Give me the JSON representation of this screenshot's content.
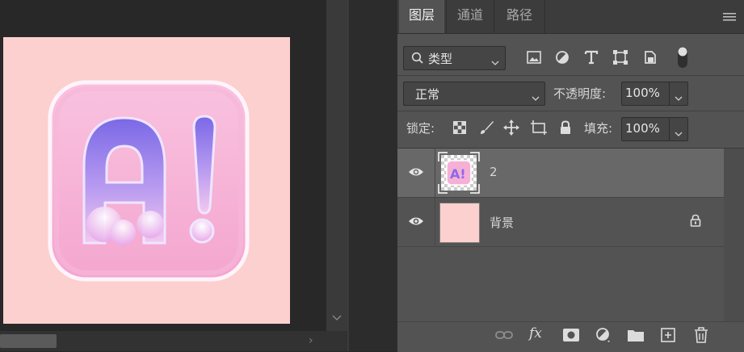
{
  "panel": {
    "tabs": [
      {
        "label": "图层",
        "active": true
      },
      {
        "label": "通道",
        "active": false
      },
      {
        "label": "路径",
        "active": false
      }
    ],
    "menu_icon": "hamburger-menu-icon",
    "filter": {
      "icon": "search-icon",
      "value": "类型"
    },
    "filter_icons": [
      "image-filter-icon",
      "adjustment-filter-icon",
      "type-filter-icon",
      "shape-filter-icon",
      "smart-object-filter-icon",
      "filter-toggle-icon"
    ],
    "blend_mode": "正常",
    "opacity": {
      "label": "不透明度:",
      "value": "100%"
    },
    "lock": {
      "label": "锁定:",
      "icons": [
        "lock-transparent-pixels-icon",
        "lock-image-pixels-icon",
        "lock-position-icon",
        "lock-artboard-icon",
        "lock-all-icon"
      ]
    },
    "fill": {
      "label": "填充:",
      "value": "100%"
    },
    "layers": [
      {
        "name": "2",
        "visible": true,
        "selected": true,
        "locked": false
      },
      {
        "name": "背景",
        "visible": true,
        "selected": false,
        "locked": true
      }
    ],
    "footer_icons": [
      "link-layers-icon",
      "fx-icon",
      "add-mask-icon",
      "new-adjustment-layer-icon",
      "new-group-icon",
      "new-layer-icon",
      "delete-layer-icon"
    ]
  },
  "canvas": {
    "artwork_text": "A!",
    "background_color": "#fcd0cf"
  }
}
